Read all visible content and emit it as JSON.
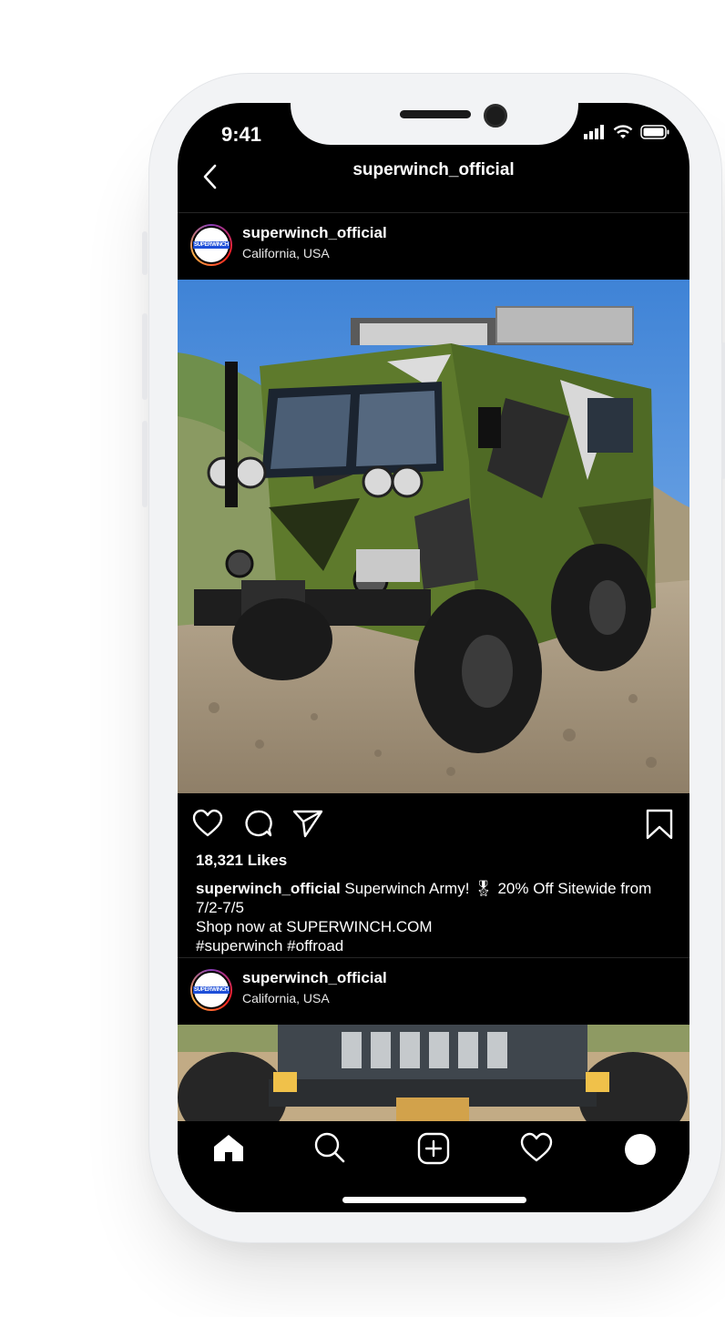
{
  "status_bar": {
    "time": "9:41"
  },
  "header": {
    "title": "superwinch_official"
  },
  "posts": [
    {
      "username": "superwinch_official",
      "location": "California, USA",
      "avatar_text": "SUPERWINCH",
      "likes": "18,321 Likes",
      "caption": {
        "username": "superwinch_official",
        "line1": " Superwinch Army! 🎖 20% Off Sitewide from 7/2-7/5",
        "line2": "Shop now at SUPERWINCH.COM",
        "line3": "#superwinch #offroad"
      }
    },
    {
      "username": "superwinch_official",
      "location": "California, USA",
      "avatar_text": "SUPERWINCH"
    }
  ],
  "icons": {
    "back": "chevron-left-icon",
    "like": "heart-icon",
    "comment": "comment-icon",
    "share": "send-icon",
    "save": "bookmark-icon",
    "nav_home": "home-icon",
    "nav_search": "search-icon",
    "nav_add": "add-post-icon",
    "nav_activity": "heart-icon",
    "nav_profile": "profile-icon"
  },
  "colors": {
    "screen_bg": "#000000",
    "text": "#ffffff",
    "divider": "#262626",
    "phone_frame": "#f2f3f5"
  }
}
